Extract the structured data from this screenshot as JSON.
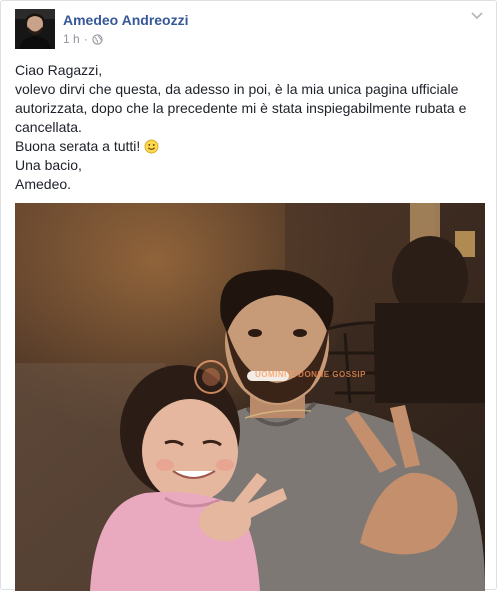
{
  "post": {
    "author": "Amedeo Andreozzi",
    "time": "1 h",
    "separator": "·",
    "privacy_icon": "globe-icon",
    "menu_icon": "chevron-down-icon",
    "lines": [
      "Ciao Ragazzi,",
      "volevo dirvi che questa, da adesso in poi, è la mia unica pagina ufficiale autorizzata, dopo che la precedente mi è stata inspiegabilmente rubata e cancellata.",
      "Buona serata a tutti!",
      "Una bacio,",
      "Amedeo."
    ],
    "emoji_icon": "smiley-icon",
    "photo_watermark": "UOMINI E DONNE GOSSIP"
  },
  "colors": {
    "author_link": "#365899",
    "meta_text": "#90949c",
    "body_text": "#1d2129",
    "border": "#dddfe2"
  }
}
